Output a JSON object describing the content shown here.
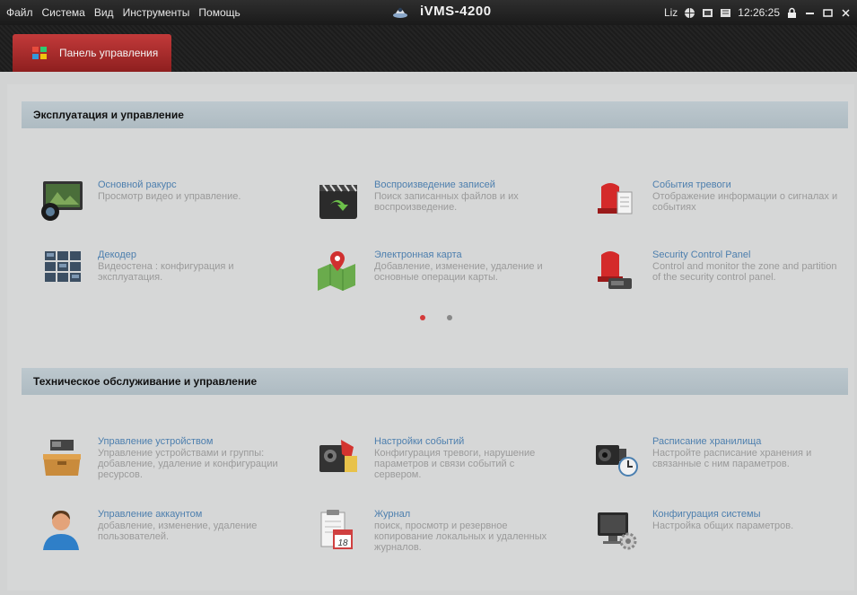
{
  "menu": {
    "items": [
      "Файл",
      "Система",
      "Вид",
      "Инструменты",
      "Помощь"
    ]
  },
  "app": {
    "title": "iVMS-4200",
    "logo_icon": "camera-logo-icon"
  },
  "tray": {
    "user": "Liz",
    "time": "12:26:25",
    "icons": [
      "globe-icon",
      "cpu-icon",
      "ram-icon",
      "lock-icon",
      "minimize-icon",
      "maximize-icon",
      "close-icon"
    ]
  },
  "tab": {
    "label": "Панель управления",
    "icon": "control-panel-icon",
    "color": "#b22f2f"
  },
  "sections": {
    "operation": {
      "title": "Эксплуатация и управление",
      "items": [
        {
          "title": "Основной ракурс",
          "desc": "Просмотр видео и управление.",
          "icon": "main-view-icon"
        },
        {
          "title": "Воспроизведение записей",
          "desc": "Поиск записанных файлов и их воспроизведение.",
          "icon": "playback-icon"
        },
        {
          "title": "События тревоги",
          "desc": "Отображение информации о сигналах и событиях",
          "icon": "alarm-events-icon"
        },
        {
          "title": "Декодер",
          "desc": "Видеостена : конфигурация и эксплуатация.",
          "icon": "decoder-icon"
        },
        {
          "title": "Электронная карта",
          "desc": "Добавление, изменение, удаление и основные операции карты.",
          "icon": "emap-icon"
        },
        {
          "title": "Security Control Panel",
          "desc": "Control and monitor the zone and partition of the security control panel.",
          "icon": "security-panel-icon"
        }
      ]
    },
    "maintenance": {
      "title": "Техническое обслуживание и управление",
      "items": [
        {
          "title": "Управление устройством",
          "desc": "Управление устройствами и группы: добавление, удаление и конфигурации ресурсов.",
          "icon": "device-management-icon"
        },
        {
          "title": "Настройки событий",
          "desc": "Конфигурация тревоги, нарушение параметров и связи событий с сервером.",
          "icon": "event-settings-icon"
        },
        {
          "title": "Расписание хранилища",
          "desc": "Настройте расписание хранения и связанные с ним параметров.",
          "icon": "storage-schedule-icon"
        },
        {
          "title": "Управление аккаунтом",
          "desc": "добавление, изменение, удаление пользователей.",
          "icon": "account-management-icon"
        },
        {
          "title": "Журнал",
          "desc": "поиск, просмотр и резервное копирование локальных и удаленных журналов.",
          "icon": "log-icon"
        },
        {
          "title": "Конфигурация системы",
          "desc": "Настройка общих параметров.",
          "icon": "system-config-icon"
        }
      ]
    }
  },
  "pager": {
    "active_color": "#d43a3a",
    "inactive_color": "#888888"
  },
  "log_icon_day": "18"
}
